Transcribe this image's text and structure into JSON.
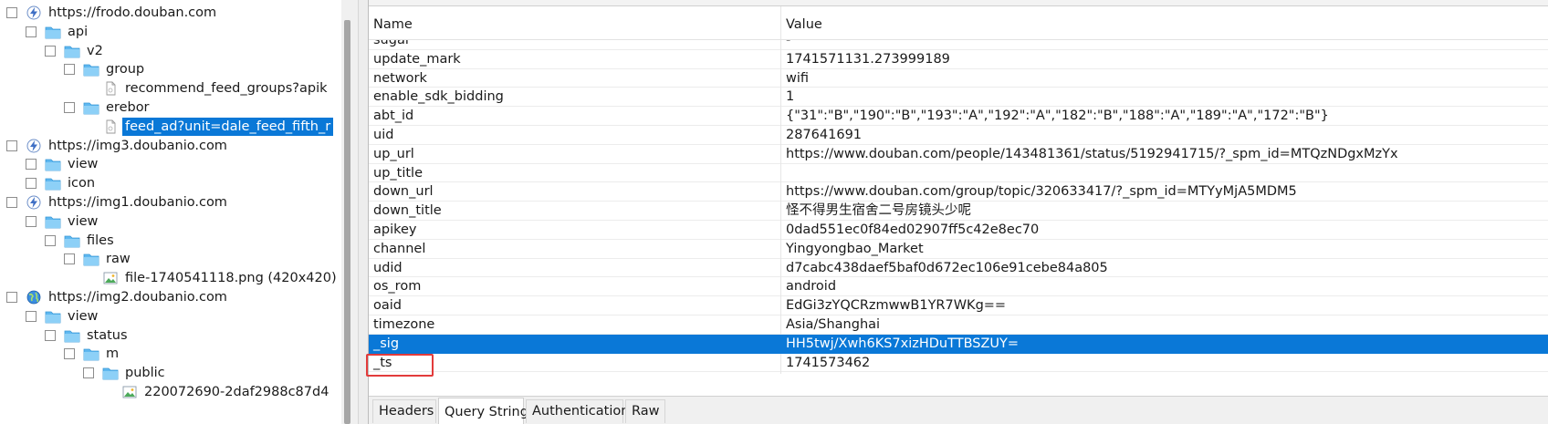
{
  "tree": {
    "items": [
      {
        "label": "https://frodo.douban.com",
        "icon": "lightning-icon",
        "indent": 0
      },
      {
        "label": "api",
        "icon": "folder-icon",
        "indent": 1
      },
      {
        "label": "v2",
        "icon": "folder-icon",
        "indent": 2
      },
      {
        "label": "group",
        "icon": "folder-icon",
        "indent": 3
      },
      {
        "label": "recommend_feed_groups?apik",
        "icon": "document-icon",
        "indent": 4
      },
      {
        "label": "erebor",
        "icon": "folder-icon",
        "indent": 3
      },
      {
        "label": "feed_ad?unit=dale_feed_fifth_r",
        "icon": "document-icon",
        "indent": 4,
        "selected": true
      },
      {
        "label": "https://img3.doubanio.com",
        "icon": "lightning-icon",
        "indent": 0
      },
      {
        "label": "view",
        "icon": "folder-icon",
        "indent": 1
      },
      {
        "label": "icon",
        "icon": "folder-icon",
        "indent": 1
      },
      {
        "label": "https://img1.doubanio.com",
        "icon": "lightning-icon",
        "indent": 0
      },
      {
        "label": "view",
        "icon": "folder-icon",
        "indent": 1
      },
      {
        "label": "files",
        "icon": "folder-icon",
        "indent": 2
      },
      {
        "label": "raw",
        "icon": "folder-icon",
        "indent": 3
      },
      {
        "label": "file-1740541118.png (420x420)",
        "icon": "image-icon",
        "indent": 4
      },
      {
        "label": "https://img2.doubanio.com",
        "icon": "globe-icon",
        "indent": 0
      },
      {
        "label": "view",
        "icon": "folder-icon",
        "indent": 1
      },
      {
        "label": "status",
        "icon": "folder-icon",
        "indent": 2
      },
      {
        "label": "m",
        "icon": "folder-icon",
        "indent": 3
      },
      {
        "label": "public",
        "icon": "folder-icon",
        "indent": 4
      },
      {
        "label": "220072690-2daf2988c87d4",
        "icon": "image-icon",
        "indent": 5
      }
    ]
  },
  "grid": {
    "columns": {
      "name": "Name",
      "value": "Value"
    },
    "rows": [
      {
        "name": "sugar",
        "value": "-"
      },
      {
        "name": "update_mark",
        "value": "1741571131.273999189"
      },
      {
        "name": "network",
        "value": "wifi"
      },
      {
        "name": "enable_sdk_bidding",
        "value": "1"
      },
      {
        "name": "abt_id",
        "value": "{\"31\":\"B\",\"190\":\"B\",\"193\":\"A\",\"192\":\"A\",\"182\":\"B\",\"188\":\"A\",\"189\":\"A\",\"172\":\"B\"}"
      },
      {
        "name": "uid",
        "value": "287641691"
      },
      {
        "name": "up_url",
        "value": "https://www.douban.com/people/143481361/status/5192941715/?_spm_id=MTQzNDgxMzYx"
      },
      {
        "name": "up_title",
        "value": ""
      },
      {
        "name": "down_url",
        "value": "https://www.douban.com/group/topic/320633417/?_spm_id=MTYyMjA5MDM5"
      },
      {
        "name": "down_title",
        "value": "怪不得男生宿舍二号房镜头少呢"
      },
      {
        "name": "apikey",
        "value": "0dad551ec0f84ed02907ff5c42e8ec70"
      },
      {
        "name": "channel",
        "value": "Yingyongbao_Market"
      },
      {
        "name": "udid",
        "value": "d7cabc438daef5baf0d672ec106e91cebe84a805"
      },
      {
        "name": "os_rom",
        "value": "android"
      },
      {
        "name": "oaid",
        "value": "EdGi3zYQCRzmwwB1YR7WKg=="
      },
      {
        "name": "timezone",
        "value": "Asia/Shanghai"
      },
      {
        "name": "_sig",
        "value": "HH5twj/Xwh6KS7xizHDuTTBSZUY=",
        "selected": true
      },
      {
        "name": "_ts",
        "value": "1741573462"
      }
    ]
  },
  "tabs": [
    {
      "label": "Headers",
      "active": false
    },
    {
      "label": "Query String",
      "active": true
    },
    {
      "label": "Authentication",
      "active": false
    },
    {
      "label": "Raw",
      "active": false
    }
  ],
  "colors": {
    "selection": "#0a78d7",
    "highlight_box": "#e23b3b",
    "folder": "#5fb8f0"
  }
}
